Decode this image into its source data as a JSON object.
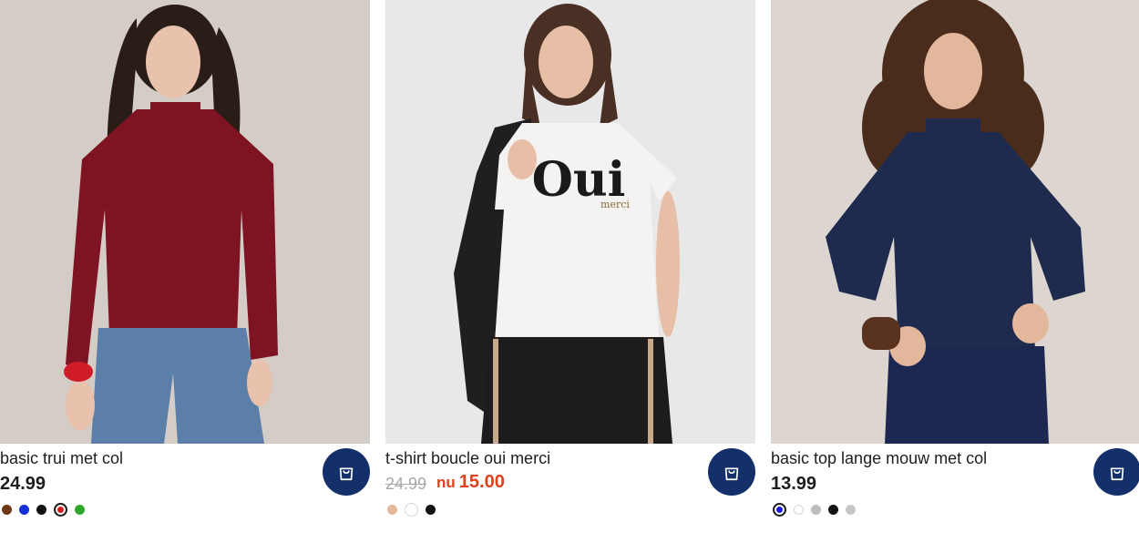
{
  "products": [
    {
      "name": "basic trui met col",
      "price": "24.99",
      "colors": [
        "#6b3a14",
        "#1430d8",
        "#111111",
        "#d41e1e",
        "#2ea82a"
      ],
      "selected_color_index": 3
    },
    {
      "name": "t-shirt boucle oui merci",
      "price_old": "24.99",
      "price_prefix": "nu",
      "price_now": "15.00",
      "shirt_print": "Oui",
      "shirt_print_small": "merci",
      "colors": [
        "#e2b99a",
        "#ffffff",
        "#111111"
      ],
      "selected_color_index": 1
    },
    {
      "name": "basic top lange mouw met col",
      "price": "13.99",
      "colors": [
        "#1a1ad8",
        "#ffffff",
        "#bdbdbd",
        "#111111",
        "#c6c6c6"
      ],
      "selected_color_index": 0
    }
  ],
  "icons": {
    "cart": "shopping-bag-icon"
  },
  "theme": {
    "cart_button_bg": "#14306a",
    "sale_color": "#e0411d"
  }
}
